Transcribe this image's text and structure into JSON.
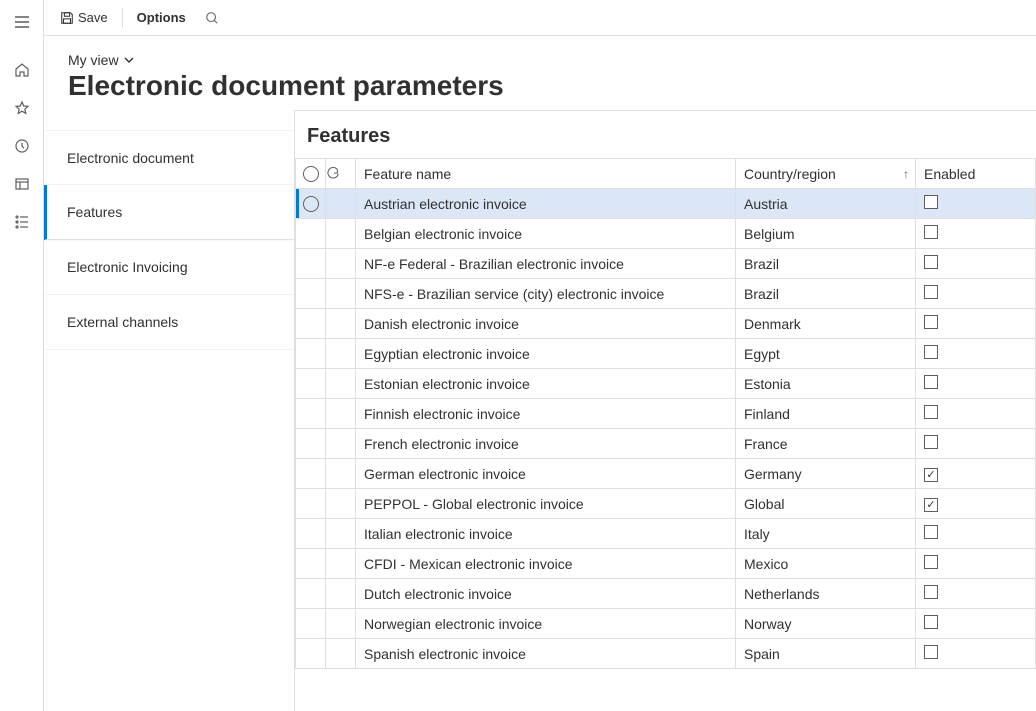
{
  "toolbar": {
    "save_label": "Save",
    "options_label": "Options"
  },
  "header": {
    "view_label": "My view",
    "page_title": "Electronic document parameters"
  },
  "vtabs": [
    {
      "label": "Electronic document",
      "active": false
    },
    {
      "label": "Features",
      "active": true
    },
    {
      "label": "Electronic Invoicing",
      "active": false
    },
    {
      "label": "External channels",
      "active": false
    }
  ],
  "panel": {
    "title": "Features",
    "columns": {
      "feature_name": "Feature name",
      "country": "Country/region",
      "enabled": "Enabled"
    }
  },
  "rows": [
    {
      "name": "Austrian electronic invoice",
      "country": "Austria",
      "enabled": false,
      "selected": true
    },
    {
      "name": "Belgian electronic invoice",
      "country": "Belgium",
      "enabled": false,
      "selected": false
    },
    {
      "name": "NF-e  Federal - Brazilian electronic invoice",
      "country": "Brazil",
      "enabled": false,
      "selected": false
    },
    {
      "name": "NFS-e - Brazilian service (city) electronic invoice",
      "country": "Brazil",
      "enabled": false,
      "selected": false
    },
    {
      "name": "Danish electronic invoice",
      "country": "Denmark",
      "enabled": false,
      "selected": false
    },
    {
      "name": "Egyptian electronic invoice",
      "country": "Egypt",
      "enabled": false,
      "selected": false
    },
    {
      "name": "Estonian electronic invoice",
      "country": "Estonia",
      "enabled": false,
      "selected": false
    },
    {
      "name": "Finnish electronic invoice",
      "country": "Finland",
      "enabled": false,
      "selected": false
    },
    {
      "name": "French electronic invoice",
      "country": "France",
      "enabled": false,
      "selected": false
    },
    {
      "name": "German electronic invoice",
      "country": "Germany",
      "enabled": true,
      "selected": false
    },
    {
      "name": "PEPPOL - Global electronic invoice",
      "country": "Global",
      "enabled": true,
      "selected": false
    },
    {
      "name": "Italian electronic invoice",
      "country": "Italy",
      "enabled": false,
      "selected": false
    },
    {
      "name": "CFDI - Mexican electronic invoice",
      "country": "Mexico",
      "enabled": false,
      "selected": false
    },
    {
      "name": "Dutch electronic invoice",
      "country": "Netherlands",
      "enabled": false,
      "selected": false
    },
    {
      "name": "Norwegian electronic invoice",
      "country": "Norway",
      "enabled": false,
      "selected": false
    },
    {
      "name": "Spanish electronic invoice",
      "country": "Spain",
      "enabled": false,
      "selected": false
    }
  ]
}
